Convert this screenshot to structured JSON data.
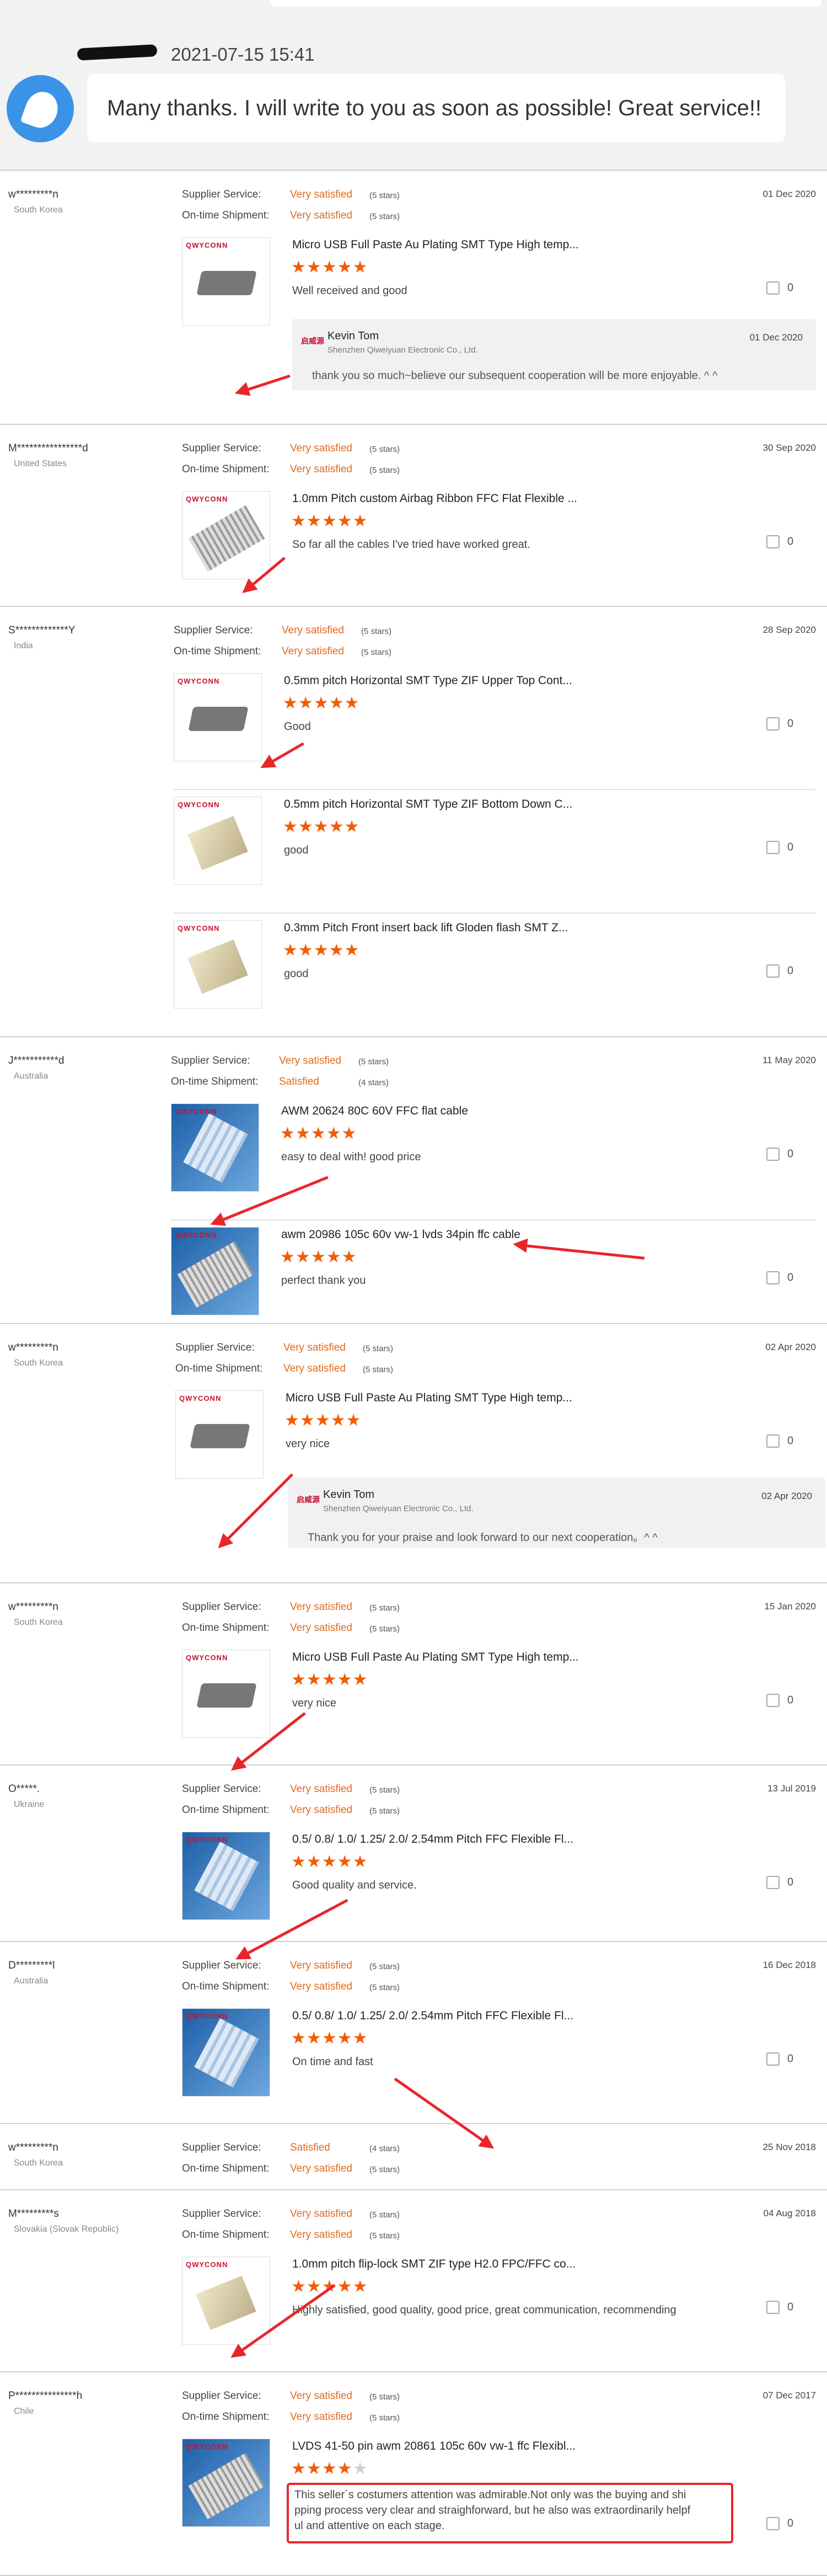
{
  "chat": {
    "timestamp": "2021-07-15 15:41",
    "message": "Many thanks. I will write to you as soon as possible! Great service!!"
  },
  "labels": {
    "supplier": "Supplier Service:",
    "shipment": "On-time Shipment:"
  },
  "reviews": [
    {
      "user": "w*********n",
      "country": "South Korea",
      "date": "01 Dec 2020",
      "supplier": "Very satisfied",
      "supplier_stars": "(5 stars)",
      "shipment": "Very satisfied",
      "shipment_stars": "(5 stars)",
      "items": [
        {
          "title": "Micro USB Full Paste Au Plating SMT Type High temp...",
          "rating": 5,
          "text": "Well received and good",
          "likes": "0"
        }
      ],
      "reply": {
        "name": "Kevin Tom",
        "company": "Shenzhen Qiweiyuan Electronic Co., Ltd.",
        "date": "01 Dec 2020",
        "text": "thank you so much~believe our subsequent cooperation will be more enjoyable. ^ ^"
      }
    },
    {
      "user": "M****************d",
      "country": "United States",
      "date": "30 Sep 2020",
      "supplier": "Very satisfied",
      "supplier_stars": "(5 stars)",
      "shipment": "Very satisfied",
      "shipment_stars": "(5 stars)",
      "items": [
        {
          "title": "1.0mm Pitch custom Airbag Ribbon FFC Flat Flexible ...",
          "rating": 5,
          "text": "So far all the cables I've tried have worked great.",
          "likes": "0"
        }
      ]
    },
    {
      "user": "S*************Y",
      "country": "India",
      "date": "28 Sep 2020",
      "supplier": "Very satisfied",
      "supplier_stars": "(5 stars)",
      "shipment": "Very satisfied",
      "shipment_stars": "(5 stars)",
      "items": [
        {
          "title": "0.5mm pitch Horizontal SMT Type ZIF Upper Top Cont...",
          "rating": 5,
          "text": "Good",
          "likes": "0"
        },
        {
          "title": "0.5mm pitch Horizontal SMT Type ZIF Bottom Down C...",
          "rating": 5,
          "text": "good",
          "likes": "0"
        },
        {
          "title": "0.3mm Pitch Front insert back lift Gloden flash SMT Z...",
          "rating": 5,
          "text": "good",
          "likes": "0"
        }
      ]
    },
    {
      "user": "J***********d",
      "country": "Australia",
      "date": "11 May 2020",
      "supplier": "Very satisfied",
      "supplier_stars": "(5 stars)",
      "shipment": "Satisfied",
      "shipment_stars": "(4 stars)",
      "items": [
        {
          "title": "AWM 20624 80C 60V FFC flat cable",
          "rating": 5,
          "text": "easy to deal with! good price",
          "likes": "0"
        },
        {
          "title": "awm 20986 105c 60v vw-1 lvds 34pin ffc cable",
          "rating": 5,
          "text": "perfect thank you",
          "likes": "0"
        }
      ]
    },
    {
      "user": "w*********n",
      "country": "South Korea",
      "date": "02 Apr 2020",
      "supplier": "Very satisfied",
      "supplier_stars": "(5 stars)",
      "shipment": "Very satisfied",
      "shipment_stars": "(5 stars)",
      "items": [
        {
          "title": "Micro USB Full Paste Au Plating SMT Type High temp...",
          "rating": 5,
          "text": "very nice",
          "likes": "0"
        }
      ],
      "reply": {
        "name": "Kevin Tom",
        "company": "Shenzhen Qiweiyuan Electronic Co., Ltd.",
        "date": "02 Apr 2020",
        "text": "Thank you for your praise and look forward to our next cooperation。^ ^"
      }
    },
    {
      "user": "w*********n",
      "country": "South Korea",
      "date": "15 Jan 2020",
      "supplier": "Very satisfied",
      "supplier_stars": "(5 stars)",
      "shipment": "Very satisfied",
      "shipment_stars": "(5 stars)",
      "items": [
        {
          "title": "Micro USB Full Paste Au Plating SMT Type High temp...",
          "rating": 5,
          "text": "very nice",
          "likes": "0"
        }
      ]
    },
    {
      "user": "O*****.",
      "country": "Ukraine",
      "date": "13 Jul 2019",
      "supplier": "Very satisfied",
      "supplier_stars": "(5 stars)",
      "shipment": "Very satisfied",
      "shipment_stars": "(5 stars)",
      "items": [
        {
          "title": "0.5/ 0.8/ 1.0/ 1.25/ 2.0/ 2.54mm Pitch FFC Flexible Fl...",
          "rating": 5,
          "text": "Good quality and service.",
          "likes": "0"
        }
      ]
    },
    {
      "user": "D*********l",
      "country": "Australia",
      "date": "16 Dec 2018",
      "supplier": "Very satisfied",
      "supplier_stars": "(5 stars)",
      "shipment": "Very satisfied",
      "shipment_stars": "(5 stars)",
      "items": [
        {
          "title": "0.5/ 0.8/ 1.0/ 1.25/ 2.0/ 2.54mm Pitch FFC Flexible Fl...",
          "rating": 5,
          "text": "On time and fast",
          "likes": "0"
        }
      ]
    },
    {
      "user": "w*********n",
      "country": "South Korea",
      "date": "25 Nov 2018",
      "supplier": "Satisfied",
      "supplier_stars": "(4 stars)",
      "shipment": "Very satisfied",
      "shipment_stars": "(5 stars)",
      "items": []
    },
    {
      "user": "M*********s",
      "country": "Slovakia (Slovak Republic)",
      "date": "04 Aug 2018",
      "supplier": "Very satisfied",
      "supplier_stars": "(5 stars)",
      "shipment": "Very satisfied",
      "shipment_stars": "(5 stars)",
      "items": [
        {
          "title": "1.0mm pitch flip-lock SMT ZIF type H2.0 FPC/FFC co...",
          "rating": 5,
          "text": "Highly satisfied, good quality, good price, great communication, recommending",
          "likes": "0"
        }
      ]
    },
    {
      "user": "P***************h",
      "country": "Chile",
      "date": "07 Dec 2017",
      "supplier": "Very satisfied",
      "supplier_stars": "(5 stars)",
      "shipment": "Very satisfied",
      "shipment_stars": "(5 stars)",
      "items": [
        {
          "title": "LVDS 41-50 pin awm 20861 105c 60v vw-1 ffc Flexibl...",
          "rating": 4,
          "text": "This seller´s costumers attention was admirable.Not only was  the buying and shi\npping process very clear and straighforward, but he also was extraordinarily helpf\nul and attentive on each stage.",
          "likes": "0"
        }
      ]
    }
  ],
  "brand_logo": "QWYCONN",
  "reply_logo": "启威源",
  "colors": {
    "accent": "#e06b1f",
    "star": "#f25c05",
    "annotation": "#e8262a"
  }
}
